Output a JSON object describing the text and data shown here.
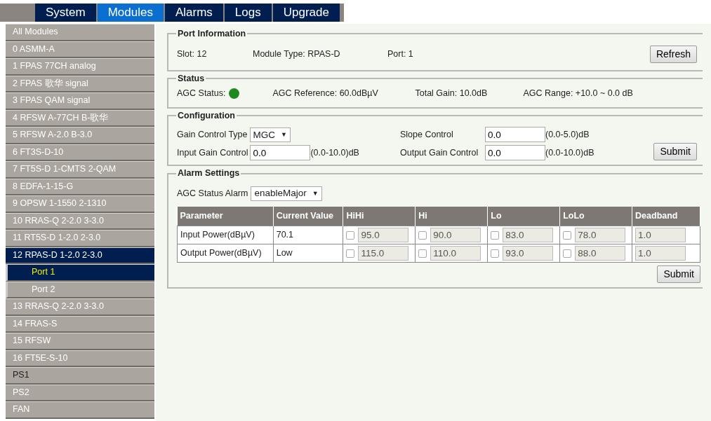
{
  "top_tabs": [
    {
      "label": "System",
      "selected": false
    },
    {
      "label": "Modules",
      "selected": true
    },
    {
      "label": "Alarms",
      "selected": false
    },
    {
      "label": "Logs",
      "selected": false
    },
    {
      "label": "Upgrade",
      "selected": false
    }
  ],
  "sidebar": {
    "items": [
      {
        "label": "All Modules",
        "selected": false,
        "hovered": false
      },
      {
        "label": "0 ASMM-A",
        "selected": false,
        "hovered": false
      },
      {
        "label": "1 FPAS 77CH analog",
        "selected": false,
        "hovered": false
      },
      {
        "label": "2 FPAS 歌华 signal",
        "selected": false,
        "hovered": false
      },
      {
        "label": "3 FPAS QAM signal",
        "selected": false,
        "hovered": false
      },
      {
        "label": "4 RFSW A-77CH B-歌华",
        "selected": false,
        "hovered": false
      },
      {
        "label": "5 RFSW A-2.0 B-3.0",
        "selected": false,
        "hovered": false
      },
      {
        "label": "6 FT3S-D-10",
        "selected": false,
        "hovered": false
      },
      {
        "label": "7 FT5S-D 1-CMTS 2-QAM",
        "selected": false,
        "hovered": false
      },
      {
        "label": "8 EDFA-1-15-G",
        "selected": false,
        "hovered": false
      },
      {
        "label": "9 OPSW 1-1550 2-1310",
        "selected": false,
        "hovered": false
      },
      {
        "label": "10 RRAS-Q 2-2.0 3-3.0",
        "selected": false,
        "hovered": false
      },
      {
        "label": "11 RT5S-D 1-2.0 2-3.0",
        "selected": false,
        "hovered": false
      },
      {
        "label": "12 RPAS-D 1-2.0 2-3.0",
        "selected": true,
        "hovered": false,
        "children": [
          {
            "label": "Port 1",
            "selected": true,
            "hovered": false
          },
          {
            "label": "Port 2",
            "selected": false,
            "hovered": false
          }
        ]
      },
      {
        "label": "13 RRAS-Q 2-2.0 3-3.0",
        "selected": false,
        "hovered": false
      },
      {
        "label": "14 FRAS-S",
        "selected": false,
        "hovered": false
      },
      {
        "label": "15 RFSW",
        "selected": false,
        "hovered": false
      },
      {
        "label": "16 FT5E-S-10",
        "selected": false,
        "hovered": false
      },
      {
        "label": "PS1",
        "selected": false,
        "hovered": true
      },
      {
        "label": "PS2",
        "selected": false,
        "hovered": false
      },
      {
        "label": "FAN",
        "selected": false,
        "hovered": false
      }
    ]
  },
  "port_information": {
    "title": "Port Information",
    "slot": "Slot: 12",
    "module_type": "Module Type: RPAS-D",
    "port": "Port: 1",
    "refresh_button": "Refresh"
  },
  "status": {
    "title": "Status",
    "agc_status_label": "AGC Status:",
    "agc_status_ok": true,
    "agc_reference": "AGC Reference: 60.0dBµV",
    "total_gain": "Total Gain: 10.0dB",
    "agc_range": "AGC Range: +10.0 ~ 0.0 dB"
  },
  "configuration": {
    "title": "Configuration",
    "gain_control_type": {
      "label": "Gain Control Type",
      "value": "MGC",
      "caret": "▼"
    },
    "slope_control": {
      "label": "Slope Control",
      "value": "0.0",
      "range": "(0.0-5.0)dB"
    },
    "input_gain_control": {
      "label": "Input Gain Control",
      "value": "0.0",
      "range": "(0.0-10.0)dB"
    },
    "output_gain_control": {
      "label": "Output Gain Control",
      "value": "0.0",
      "range": "(0.0-10.0)dB"
    },
    "submit_button": "Submit"
  },
  "alarm_settings": {
    "title": "Alarm Settings",
    "agc_status_alarm": {
      "label": "AGC Status Alarm",
      "value": "enableMajor",
      "caret": "▼"
    },
    "table": {
      "columns": [
        "Parameter",
        "Current Value",
        "HiHi",
        "Hi",
        "Lo",
        "LoLo",
        "Deadband"
      ],
      "rows": [
        {
          "parameter": "Input Power(dBµV)",
          "current_value": "70.1",
          "thresholds": [
            {
              "checked": false,
              "value": "95.0",
              "disabled": true
            },
            {
              "checked": false,
              "value": "90.0",
              "disabled": true
            },
            {
              "checked": false,
              "value": "83.0",
              "disabled": true
            },
            {
              "checked": false,
              "value": "78.0",
              "disabled": true
            }
          ],
          "deadband": {
            "value": "1.0",
            "disabled": true
          }
        },
        {
          "parameter": "Output Power(dBµV)",
          "current_value": "Low",
          "thresholds": [
            {
              "checked": false,
              "value": "115.0",
              "disabled": true
            },
            {
              "checked": false,
              "value": "110.0",
              "disabled": true
            },
            {
              "checked": false,
              "value": "93.0",
              "disabled": true
            },
            {
              "checked": false,
              "value": "88.0",
              "disabled": true
            }
          ],
          "deadband": {
            "value": "1.0",
            "disabled": true
          }
        }
      ]
    },
    "submit_button": "Submit"
  }
}
